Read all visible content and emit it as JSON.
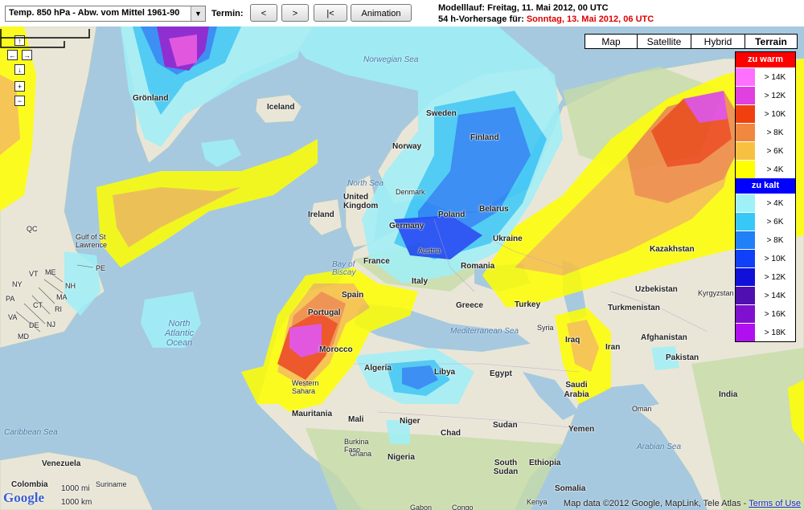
{
  "toolbar": {
    "parameter_select": "Temp. 850 hPa - Abw. vom Mittel 1961-90",
    "termin_label": "Termin:",
    "prev_button": "<",
    "next_button": ">",
    "first_button": "|<",
    "animation_button": "Animation",
    "run_line1": "Modelllauf: Freitag, 11. Mai 2012, 00 UTC",
    "run_line2_prefix": "54 h-Vorhersage für:",
    "run_line2_value": "Sonntag, 13. Mai 2012, 06 UTC"
  },
  "map_types": [
    "Map",
    "Satellite",
    "Hybrid",
    "Terrain"
  ],
  "active_map_type": "Terrain",
  "nav_controls": [
    "↑",
    "←",
    "→",
    "↓",
    "+",
    "−"
  ],
  "legend": {
    "warm_title": "zu warm",
    "warm_color": "#ff0000",
    "warm": [
      {
        "label": "> 14K",
        "color": "#ff70ff"
      },
      {
        "label": "> 12K",
        "color": "#e040e0"
      },
      {
        "label": "> 10K",
        "color": "#f04010"
      },
      {
        "label": "> 8K",
        "color": "#f08840"
      },
      {
        "label": "> 6K",
        "color": "#f8c040"
      },
      {
        "label": "> 4K",
        "color": "#ffff00"
      }
    ],
    "cold_title": "zu kalt",
    "cold_color": "#0000ff",
    "cold": [
      {
        "label": "> 4K",
        "color": "#a0f0f8"
      },
      {
        "label": "> 6K",
        "color": "#38c8f8"
      },
      {
        "label": "> 8K",
        "color": "#2080f8"
      },
      {
        "label": "> 10K",
        "color": "#1040f8"
      },
      {
        "label": "> 12K",
        "color": "#1010d8"
      },
      {
        "label": "> 14K",
        "color": "#5010b0"
      },
      {
        "label": "> 16K",
        "color": "#8010d0"
      },
      {
        "label": "> 18K",
        "color": "#b010f0"
      }
    ]
  },
  "places": {
    "gronland": "Grönland",
    "iceland": "Iceland",
    "norwegian_sea": "Norwegian Sea",
    "sweden": "Sweden",
    "finland": "Finland",
    "norway": "Norway",
    "north_sea": "North Sea",
    "denmark": "Denmark",
    "uk": "United Kingdom",
    "ireland": "Ireland",
    "germany": "Germany",
    "poland": "Poland",
    "belarus": "Belarus",
    "ukraine": "Ukraine",
    "austria": "Austria",
    "france": "France",
    "bay_of_biscay": "Bay of Biscay",
    "romania": "Romania",
    "italy": "Italy",
    "spain": "Spain",
    "portugal": "Portugal",
    "greece": "Greece",
    "turkey": "Turkey",
    "kazakhstan": "Kazakhstan",
    "uzbekistan": "Uzbekistan",
    "turkmenistan": "Turkmenistan",
    "kyrgyzstan": "Kyrgyzstan",
    "afghanistan": "Afghanistan",
    "pakistan": "Pakistan",
    "iran": "Iran",
    "iraq": "Iraq",
    "syria": "Syria",
    "mediterranean": "Mediterranean Sea",
    "morocco": "Morocco",
    "western_sahara": "Western Sahara",
    "algeria": "Algeria",
    "libya": "Libya",
    "egypt": "Egypt",
    "saudi_arabia": "Saudi Arabia",
    "yemen": "Yemen",
    "india": "India",
    "arabian_sea": "Arabian Sea",
    "mauritania": "Mauritania",
    "mali": "Mali",
    "niger": "Niger",
    "chad": "Chad",
    "sudan": "Sudan",
    "ethiopia": "Ethiopia",
    "south_sudan": "South Sudan",
    "somalia": "Somalia",
    "nigeria": "Nigeria",
    "ghana": "Ghana",
    "burkina_faso": "Burkina Faso",
    "north_atlantic": "North Atlantic Ocean",
    "caribbean": "Caribbean Sea",
    "venezuela": "Venezuela",
    "colombia": "Colombia",
    "suriname": "Suriname",
    "gulf_st_lawrence": "Gulf of St Lawrence",
    "qc": "QC",
    "pe": "PE",
    "me": "ME",
    "nh": "NH",
    "ma": "MA",
    "ri": "RI",
    "ct": "CT",
    "vt": "VT",
    "ny": "NY",
    "pa": "PA",
    "nj": "NJ",
    "de": "DE",
    "md": "MD",
    "va": "VA",
    "gabon": "Gabon",
    "congo": "Congo",
    "kenya": "Kenya",
    "oman": "Oman"
  },
  "scale": {
    "miles": "1000 mi",
    "km": "1000 km"
  },
  "logo": "Google",
  "attribution": "Map data ©2012 Google, MapLink, Tele Atlas -",
  "terms_link": "Terms of Use"
}
